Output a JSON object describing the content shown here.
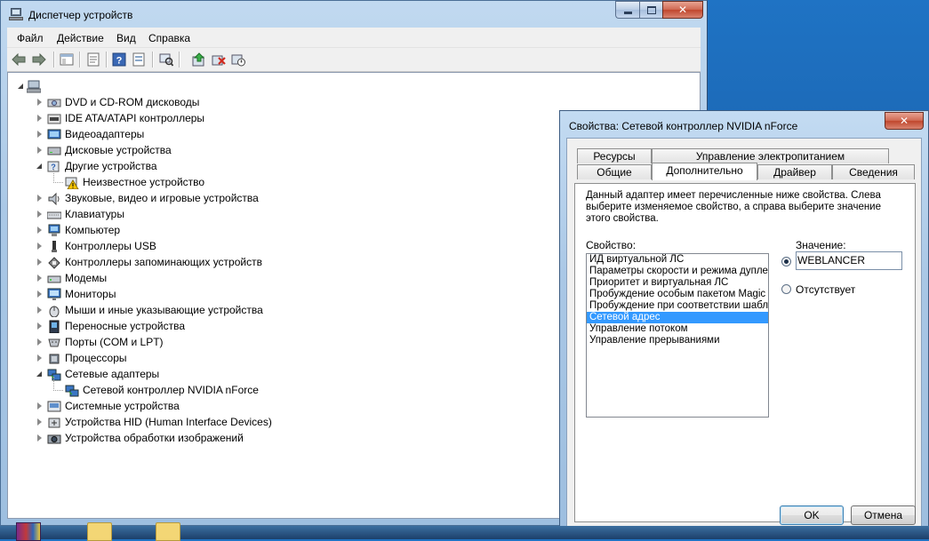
{
  "main_window": {
    "title": "Диспетчер устройств",
    "caption": {
      "minimize": "",
      "maximize": "",
      "close": "✕"
    },
    "menu": [
      "Файл",
      "Действие",
      "Вид",
      "Справка"
    ],
    "toolbar": [
      "back-arrow-icon",
      "forward-arrow-icon",
      "show-tree-icon",
      "properties-icon",
      "help-icon",
      "scan-hardware-icon",
      "update-driver-icon",
      "uninstall-icon",
      "disable-device-icon"
    ],
    "tree": {
      "root": "",
      "items": [
        {
          "label": "DVD и CD-ROM дисководы",
          "icon": "dvd-drive-icon",
          "expanded": false
        },
        {
          "label": "IDE ATA/ATAPI контроллеры",
          "icon": "ide-controller-icon",
          "expanded": false
        },
        {
          "label": "Видеоадаптеры",
          "icon": "display-adapter-icon",
          "expanded": false
        },
        {
          "label": "Дисковые устройства",
          "icon": "disk-drive-icon",
          "expanded": false
        },
        {
          "label": "Другие устройства",
          "icon": "other-devices-icon",
          "expanded": true
        },
        {
          "label": "Неизвестное устройство",
          "icon": "unknown-device-warning-icon",
          "child": true
        },
        {
          "label": "Звуковые, видео и игровые устройства",
          "icon": "sound-icon",
          "expanded": false
        },
        {
          "label": "Клавиатуры",
          "icon": "keyboard-icon",
          "expanded": false
        },
        {
          "label": "Компьютер",
          "icon": "computer-icon",
          "expanded": false
        },
        {
          "label": "Контроллеры USB",
          "icon": "usb-icon",
          "expanded": false
        },
        {
          "label": "Контроллеры запоминающих устройств",
          "icon": "storage-controller-icon",
          "expanded": false
        },
        {
          "label": "Модемы",
          "icon": "modem-icon",
          "expanded": false
        },
        {
          "label": "Мониторы",
          "icon": "monitor-icon",
          "expanded": false
        },
        {
          "label": "Мыши и иные указывающие устройства",
          "icon": "mouse-icon",
          "expanded": false
        },
        {
          "label": "Переносные устройства",
          "icon": "portable-device-icon",
          "expanded": false
        },
        {
          "label": "Порты (COM и LPT)",
          "icon": "port-icon",
          "expanded": false
        },
        {
          "label": "Процессоры",
          "icon": "processor-icon",
          "expanded": false
        },
        {
          "label": "Сетевые адаптеры",
          "icon": "network-adapter-icon",
          "expanded": true
        },
        {
          "label": "Сетевой контроллер NVIDIA nForce",
          "icon": "network-card-icon",
          "child": true
        },
        {
          "label": "Системные устройства",
          "icon": "system-device-icon",
          "expanded": false
        },
        {
          "label": "Устройства HID (Human Interface Devices)",
          "icon": "hid-icon",
          "expanded": false
        },
        {
          "label": "Устройства обработки изображений",
          "icon": "imaging-device-icon",
          "expanded": false
        }
      ]
    }
  },
  "dialog": {
    "title": "Свойства: Сетевой контроллер NVIDIA nForce",
    "close": "✕",
    "tabs_back": [
      "Ресурсы",
      "Управление электропитанием"
    ],
    "tabs_front": [
      "Общие",
      "Дополнительно",
      "Драйвер",
      "Сведения"
    ],
    "active_tab": "Дополнительно",
    "description": "Данный адаптер имеет перечисленные ниже свойства. Слева выберите изменяемое свойство, а справа выберите значение этого свойства.",
    "property_label": "Свойство:",
    "value_label": "Значение:",
    "properties": [
      "ИД виртуальной ЛС",
      "Параметры скорости и режима дуплекса",
      "Приоритет и виртуальная ЛС",
      "Пробуждение особым пакетом Magic",
      "Пробуждение при соответствии шаблону",
      "Сетевой адрес",
      "Управление потоком",
      "Управление прерываниями"
    ],
    "selected_property": "Сетевой адрес",
    "value": "WEBLANCER",
    "absent_label": "Отсутствует",
    "ok": "OK",
    "cancel": "Отмена"
  },
  "colors": {
    "selection": "#3399ff",
    "titlebar": "#b9d3ee",
    "close_button": "#c9503a"
  }
}
